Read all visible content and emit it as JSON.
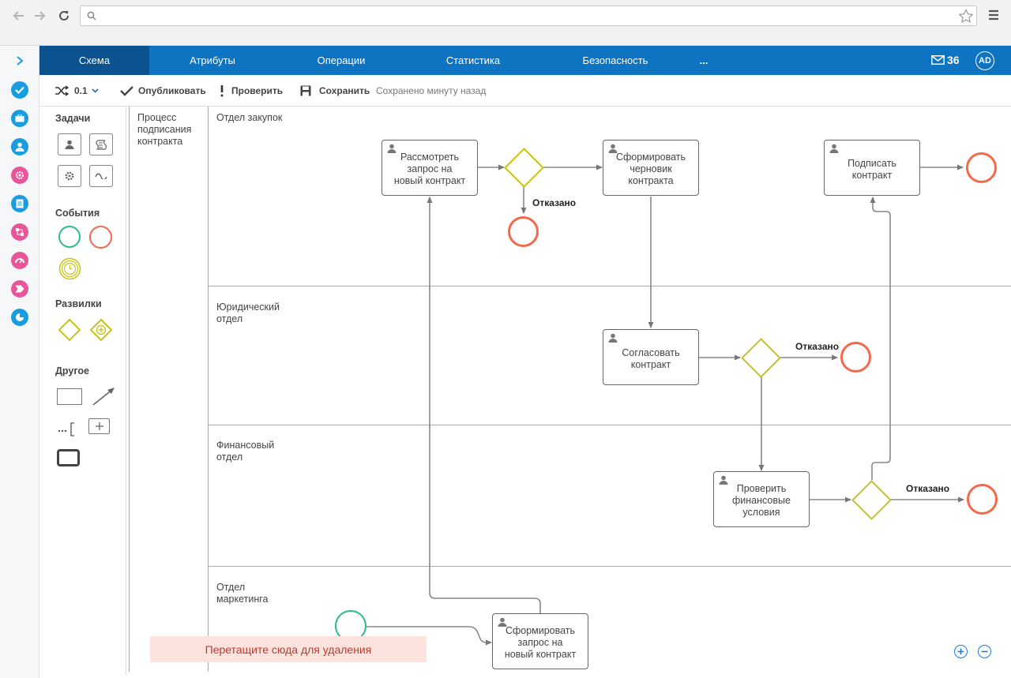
{
  "tabs": [
    {
      "label": "Схема",
      "active": true
    },
    {
      "label": "Атрибуты"
    },
    {
      "label": "Операции"
    },
    {
      "label": "Статистика"
    },
    {
      "label": "Безопасность"
    },
    {
      "label": "..."
    }
  ],
  "header": {
    "mail_count": "36",
    "avatar": "AD",
    "mail_icon": "envelope-icon"
  },
  "toolbar": {
    "version": "0.1",
    "publish": "Опубликовать",
    "check": "Проверить",
    "save": "Сохранить",
    "status": "Сохранено минуту назад"
  },
  "palette": {
    "tasks": "Задачи",
    "events": "События",
    "gateways": "Развилки",
    "other": "Другое"
  },
  "diagram": {
    "pool": "Процесс подписания контракта",
    "lanes": [
      "Отдел закупок",
      "Юридический отдел",
      "Финансовый отдел",
      "Отдел маркетинга"
    ],
    "tasks": {
      "review": "Рассмотреть запрос на новый контракт",
      "draft": "Сформировать черновик контракта",
      "sign": "Подписать контракт",
      "approve": "Согласовать контракт",
      "finance": "Проверить финансовые условия",
      "request": "Сформировать запрос на новый контракт"
    },
    "rejected": "Отказано"
  },
  "dropzone": "Перетащите сюда для удаления",
  "colors": {
    "tab_bar": "#0e73c1",
    "tab_active": "#0a5290",
    "gateway": "#c8c21a",
    "end_event": "#f26a4b",
    "start_event": "#2db88e",
    "rail_icons": [
      "#1a9ce0",
      "#1a9ce0",
      "#1a9ce0",
      "#e8559b",
      "#1a9ce0",
      "#e8559b",
      "#e8559b",
      "#e8559b",
      "#1a9ce0"
    ]
  }
}
